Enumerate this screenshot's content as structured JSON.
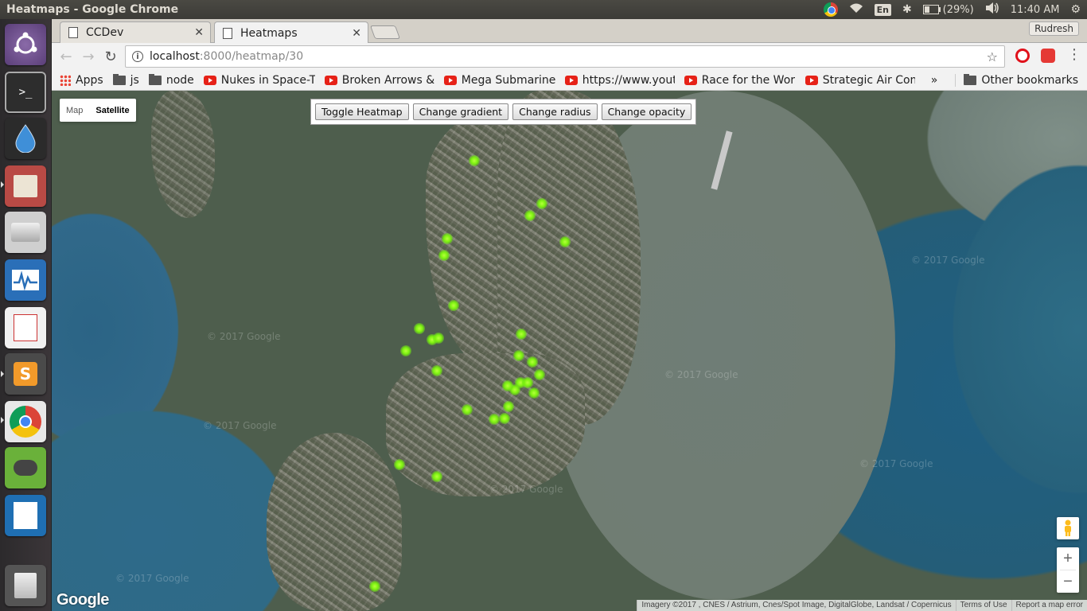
{
  "window": {
    "title": "Heatmaps - Google Chrome"
  },
  "panel": {
    "battery": "(29%)",
    "clock": "11:40 AM",
    "lang": "En"
  },
  "tabs": [
    {
      "label": "CCDev"
    },
    {
      "label": "Heatmaps"
    }
  ],
  "profile": "Rudresh",
  "address": {
    "host": "localhost",
    "path": ":8000/heatmap/30"
  },
  "bookmarks": {
    "apps": "Apps",
    "items": [
      "js",
      "node",
      "Nukes in Space-The",
      "Broken Arrows & In",
      "Mega Submarine: T",
      "https://www.youtu",
      "Race for the World",
      "Strategic Air Comm"
    ],
    "overflow": "»",
    "other": "Other bookmarks"
  },
  "map": {
    "type_map": "Map",
    "type_satellite": "Satellite",
    "watermark": "© 2017 Google",
    "logo": "Google",
    "attribution": "Imagery ©2017 , CNES / Astrium, Cnes/Spot Image, DigitalGlobe, Landsat / Copernicus",
    "terms": "Terms of Use",
    "report": "Report a map error",
    "zoom_in": "+",
    "zoom_out": "−"
  },
  "controls": {
    "toggle": "Toggle Heatmap",
    "gradient": "Change gradient",
    "radius": "Change radius",
    "opacity": "Change opacity"
  },
  "colors": {
    "heat": "#7cf20f",
    "water": "#245d78",
    "launcher": "#2c2a2c"
  }
}
